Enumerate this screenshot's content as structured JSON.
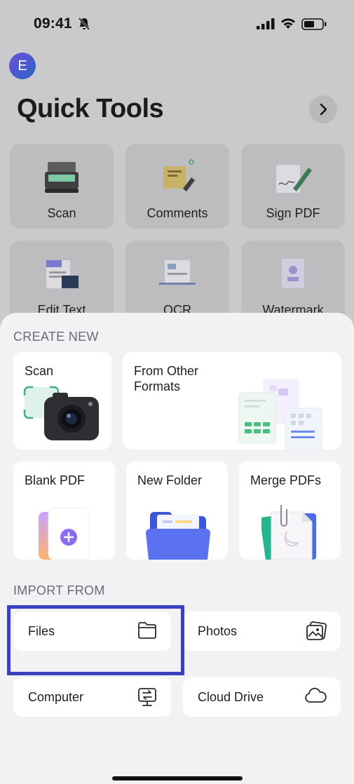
{
  "status_bar": {
    "time": "09:41"
  },
  "header": {
    "avatar_letter": "E",
    "title": "Quick Tools"
  },
  "quick_tools": [
    {
      "label": "Scan"
    },
    {
      "label": "Comments"
    },
    {
      "label": "Sign PDF"
    },
    {
      "label": "Edit Text"
    },
    {
      "label": "OCR"
    },
    {
      "label": "Watermark"
    }
  ],
  "create_new": {
    "section_title": "CREATE NEW",
    "scan_label": "Scan",
    "from_other_formats_label": "From Other\nFormats",
    "blank_pdf_label": "Blank PDF",
    "new_folder_label": "New Folder",
    "merge_pdfs_label": "Merge PDFs"
  },
  "import_from": {
    "section_title": "IMPORT FROM",
    "files_label": "Files",
    "photos_label": "Photos",
    "computer_label": "Computer",
    "cloud_drive_label": "Cloud Drive"
  },
  "colors": {
    "accent": "#3c3fbf",
    "purple": "#8b6cf0",
    "sheet_bg": "#f2f2f4"
  }
}
